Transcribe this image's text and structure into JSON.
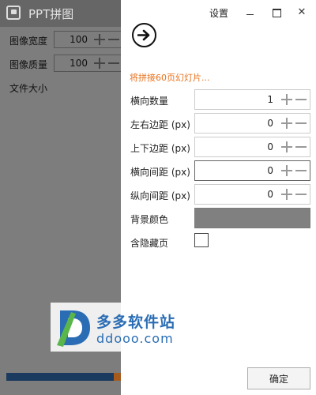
{
  "main": {
    "app_title": "PPT拼图",
    "fields": [
      {
        "label": "图像宽度",
        "value": "100"
      },
      {
        "label": "图像质量",
        "value": "100"
      }
    ],
    "file_size_label": "文件大小"
  },
  "settings": {
    "title": "设置",
    "close_glyph": "✕",
    "notice": "将拼接60页幻灯片...",
    "rows": [
      {
        "label": "横向数量",
        "value": "1"
      },
      {
        "label": "左右边距 (px)",
        "value": "0"
      },
      {
        "label": "上下边距 (px)",
        "value": "0"
      },
      {
        "label": "横向间距 (px)",
        "value": "0"
      },
      {
        "label": "纵向间距 (px)",
        "value": "0"
      }
    ],
    "bg_color_label": "背景颜色",
    "bg_color": "#808080",
    "include_hidden_label": "含隐藏页",
    "include_hidden_checked": false,
    "ok_label": "确定"
  },
  "watermark": {
    "name": "多多软件站",
    "url": "ddooo.com"
  },
  "colors": {
    "accent_orange": "#e8711c",
    "watermark_blue": "#2a6db4"
  }
}
